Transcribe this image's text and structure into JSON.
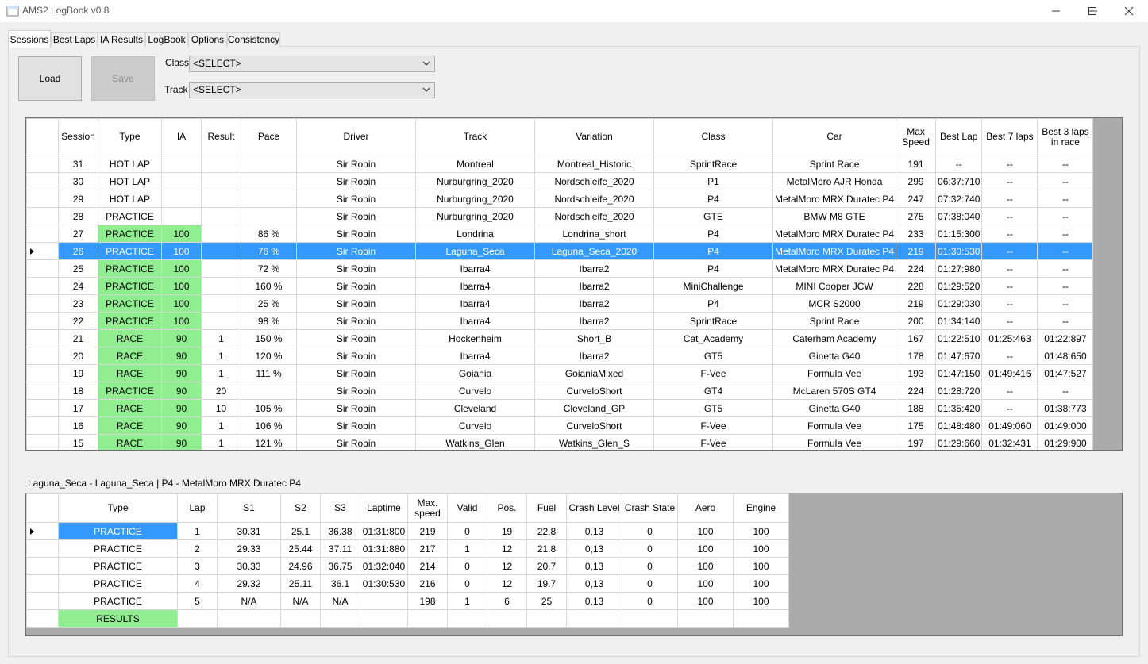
{
  "window": {
    "title": "AMS2 LogBook v0.8",
    "controls": [
      "minimize",
      "maximize",
      "close"
    ]
  },
  "tabs": [
    "Sessions",
    "Best Laps",
    "IA Results",
    "LogBook",
    "Options",
    "Consistency"
  ],
  "active_tab": "Sessions",
  "toolbar": {
    "load_label": "Load",
    "save_label": "Save",
    "class_label": "Class",
    "class_value": "<SELECT>",
    "track_label": "Track",
    "track_value": "<SELECT>"
  },
  "sessions": {
    "headers": [
      "Session",
      "Type",
      "IA",
      "Result",
      "Pace",
      "Driver",
      "Track",
      "Variation",
      "Class",
      "Car",
      "Max Speed",
      "Best Lap",
      "Best 7 laps",
      "Best 3 laps in race"
    ],
    "selected_session": "26",
    "rows": [
      [
        "31",
        "HOT LAP",
        "",
        "",
        "",
        "Sir Robin",
        "Montreal",
        "Montreal_Historic",
        "SprintRace",
        "Sprint Race",
        "191",
        "--",
        "--",
        "--"
      ],
      [
        "30",
        "HOT LAP",
        "",
        "",
        "",
        "Sir Robin",
        "Nurburgring_2020",
        "Nordschleife_2020",
        "P1",
        "MetalMoro AJR Honda",
        "299",
        "06:37:710",
        "--",
        "--"
      ],
      [
        "29",
        "HOT LAP",
        "",
        "",
        "",
        "Sir Robin",
        "Nurburgring_2020",
        "Nordschleife_2020",
        "P4",
        "MetalMoro MRX Duratec P4",
        "247",
        "07:32:740",
        "--",
        "--"
      ],
      [
        "28",
        "PRACTICE",
        "",
        "",
        "",
        "Sir Robin",
        "Nurburgring_2020",
        "Nordschleife_2020",
        "GTE",
        "BMW M8 GTE",
        "275",
        "07:38:040",
        "--",
        "--"
      ],
      [
        "27",
        "PRACTICE",
        "100",
        "",
        "86 %",
        "Sir Robin",
        "Londrina",
        "Londrina_short",
        "P4",
        "MetalMoro MRX Duratec P4",
        "233",
        "01:15:300",
        "--",
        "--"
      ],
      [
        "26",
        "PRACTICE",
        "100",
        "",
        "76 %",
        "Sir Robin",
        "Laguna_Seca",
        "Laguna_Seca_2020",
        "P4",
        "MetalMoro MRX Duratec P4",
        "219",
        "01:30:530",
        "--",
        "--"
      ],
      [
        "25",
        "PRACTICE",
        "100",
        "",
        "72 %",
        "Sir Robin",
        "Ibarra4",
        "Ibarra2",
        "P4",
        "MetalMoro MRX Duratec P4",
        "224",
        "01:27:980",
        "--",
        "--"
      ],
      [
        "24",
        "PRACTICE",
        "100",
        "",
        "160 %",
        "Sir Robin",
        "Ibarra4",
        "Ibarra2",
        "MiniChallenge",
        "MINI Cooper JCW",
        "228",
        "01:29:520",
        "--",
        "--"
      ],
      [
        "23",
        "PRACTICE",
        "100",
        "",
        "25 %",
        "Sir Robin",
        "Ibarra4",
        "Ibarra2",
        "P4",
        "MCR S2000",
        "219",
        "01:29:030",
        "--",
        "--"
      ],
      [
        "22",
        "PRACTICE",
        "100",
        "",
        "98 %",
        "Sir Robin",
        "Ibarra4",
        "Ibarra2",
        "SprintRace",
        "Sprint Race",
        "200",
        "01:34:140",
        "--",
        "--"
      ],
      [
        "21",
        "RACE",
        "90",
        "1",
        "150 %",
        "Sir Robin",
        "Hockenheim",
        "Short_B",
        "Cat_Academy",
        "Caterham Academy",
        "167",
        "01:22:510",
        "01:25:463",
        "01:22:897"
      ],
      [
        "20",
        "RACE",
        "90",
        "1",
        "120 %",
        "Sir Robin",
        "Ibarra4",
        "Ibarra2",
        "GT5",
        "Ginetta G40",
        "178",
        "01:47:670",
        "--",
        "01:48:650"
      ],
      [
        "19",
        "RACE",
        "90",
        "1",
        "111 %",
        "Sir Robin",
        "Goiania",
        "GoianiaMixed",
        "F-Vee",
        "Formula Vee",
        "193",
        "01:47:150",
        "01:49:416",
        "01:47:527"
      ],
      [
        "18",
        "PRACTICE",
        "90",
        "20",
        "",
        "Sir Robin",
        "Curvelo",
        "CurveloShort",
        "GT4",
        "McLaren 570S GT4",
        "224",
        "01:28:720",
        "--",
        "--"
      ],
      [
        "17",
        "RACE",
        "90",
        "10",
        "105 %",
        "Sir Robin",
        "Cleveland",
        "Cleveland_GP",
        "GT5",
        "Ginetta G40",
        "188",
        "01:35:420",
        "--",
        "01:38:773"
      ],
      [
        "16",
        "RACE",
        "90",
        "1",
        "106 %",
        "Sir Robin",
        "Curvelo",
        "CurveloShort",
        "F-Vee",
        "Formula Vee",
        "175",
        "01:48:480",
        "01:49:060",
        "01:49:000"
      ],
      [
        "15",
        "RACE",
        "90",
        "1",
        "121 %",
        "Sir Robin",
        "Watkins_Glen",
        "Watkins_Glen_S",
        "F-Vee",
        "Formula Vee",
        "197",
        "01:29:660",
        "01:32:431",
        "01:29:900"
      ]
    ]
  },
  "detail": {
    "caption": "Laguna_Seca - Laguna_Seca   |   P4 - MetalMoro MRX Duratec P4",
    "headers": [
      "Type",
      "Lap",
      "S1",
      "S2",
      "S3",
      "Laptime",
      "Max. speed",
      "Valid",
      "Pos.",
      "Fuel",
      "Crash Level",
      "Crash State",
      "Aero",
      "Engine"
    ],
    "rows": [
      [
        "PRACTICE",
        "1",
        "30.31",
        "25.1",
        "36.38",
        "01:31:800",
        "219",
        "0",
        "19",
        "22.8",
        "0,13",
        "0",
        "100",
        "100"
      ],
      [
        "PRACTICE",
        "2",
        "29.33",
        "25.44",
        "37.11",
        "01:31:880",
        "217",
        "1",
        "12",
        "21.8",
        "0,13",
        "0",
        "100",
        "100"
      ],
      [
        "PRACTICE",
        "3",
        "30.33",
        "24.96",
        "36.75",
        "01:32:040",
        "214",
        "0",
        "12",
        "20.7",
        "0,13",
        "0",
        "100",
        "100"
      ],
      [
        "PRACTICE",
        "4",
        "29.32",
        "25.11",
        "36.1",
        "01:30:530",
        "216",
        "0",
        "12",
        "19.7",
        "0,13",
        "0",
        "100",
        "100"
      ],
      [
        "PRACTICE",
        "5",
        "N/A",
        "N/A",
        "N/A",
        "",
        "198",
        "1",
        "6",
        "25",
        "0,13",
        "0",
        "100",
        "100"
      ],
      [
        "RESULTS",
        "",
        "",
        "",
        "",
        "",
        "",
        "",
        "",
        "",
        "",
        "",
        "",
        ""
      ]
    ]
  },
  "colors": {
    "selection": "#3399ff",
    "green_cell": "#90ee90",
    "grid_background": "#ababab"
  }
}
